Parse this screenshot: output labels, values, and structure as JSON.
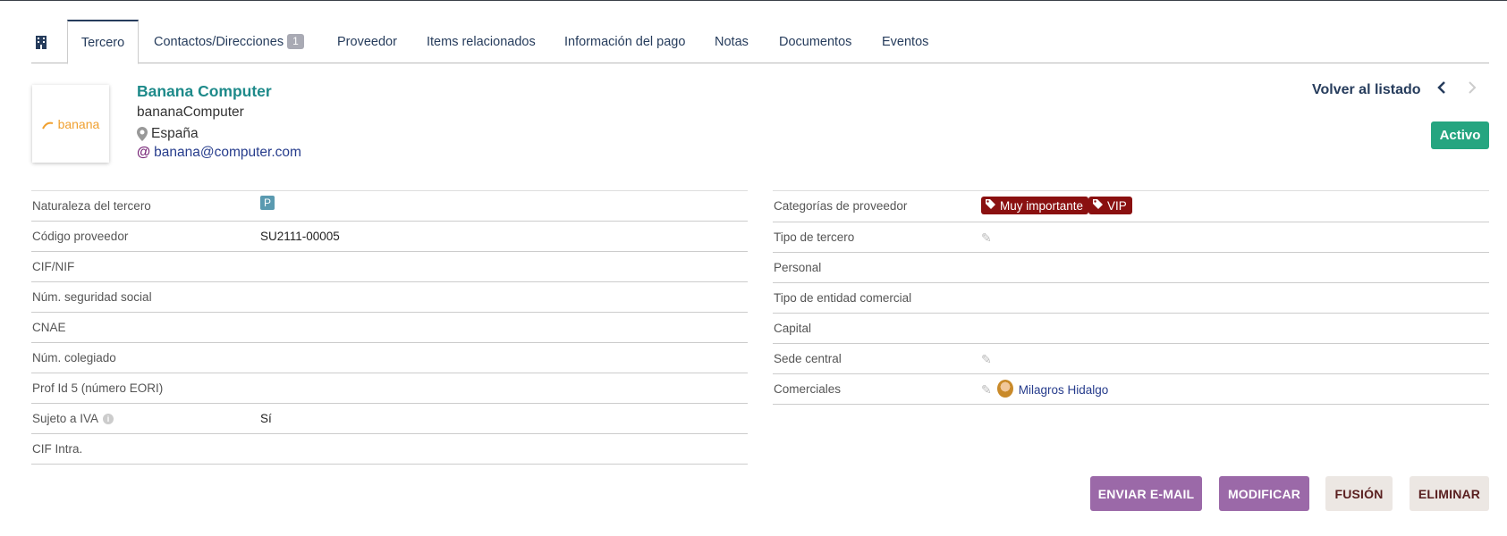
{
  "tabs": [
    {
      "label": "Tercero",
      "active": true
    },
    {
      "label": "Contactos/Direcciones",
      "badge": "1"
    },
    {
      "label": "Proveedor"
    },
    {
      "label": "Items relacionados"
    },
    {
      "label": "Información del pago"
    },
    {
      "label": "Notas"
    },
    {
      "label": "Documentos"
    },
    {
      "label": "Eventos"
    }
  ],
  "company": {
    "logo_text": "banana",
    "name": "Banana Computer",
    "alias": "bananaComputer",
    "country": "España",
    "email": "banana@computer.com"
  },
  "header": {
    "back_label": "Volver al listado",
    "status": "Activo"
  },
  "left_fields": [
    {
      "label": "Naturaleza del tercero",
      "value": "P"
    },
    {
      "label": "Código proveedor",
      "value": "SU2111-00005"
    },
    {
      "label": "CIF/NIF",
      "value": ""
    },
    {
      "label": "Núm. seguridad social",
      "value": ""
    },
    {
      "label": "CNAE",
      "value": ""
    },
    {
      "label": "Núm. colegiado",
      "value": ""
    },
    {
      "label": "Prof Id 5 (número EORI)",
      "value": ""
    },
    {
      "label": "Sujeto a IVA",
      "value": "Sí"
    },
    {
      "label": "CIF Intra.",
      "value": ""
    }
  ],
  "right_fields": [
    {
      "label": "Categorías de proveedor",
      "tags": [
        "Muy importante",
        "VIP"
      ]
    },
    {
      "label": "Tipo de tercero",
      "value": ""
    },
    {
      "label": "Personal",
      "value": ""
    },
    {
      "label": "Tipo de entidad comercial",
      "value": ""
    },
    {
      "label": "Capital",
      "value": ""
    },
    {
      "label": "Sede central",
      "value": ""
    },
    {
      "label": "Comerciales",
      "value": "Milagros Hidalgo"
    }
  ],
  "actions": {
    "send_email": "ENVIAR E-MAIL",
    "modify": "MODIFICAR",
    "merge": "FUSIÓN",
    "delete": "ELIMINAR"
  },
  "colors": {
    "accent": "#263c5c",
    "status_green": "#25a580",
    "tag_red": "#8a1010",
    "button_purple": "#9b69a8"
  }
}
